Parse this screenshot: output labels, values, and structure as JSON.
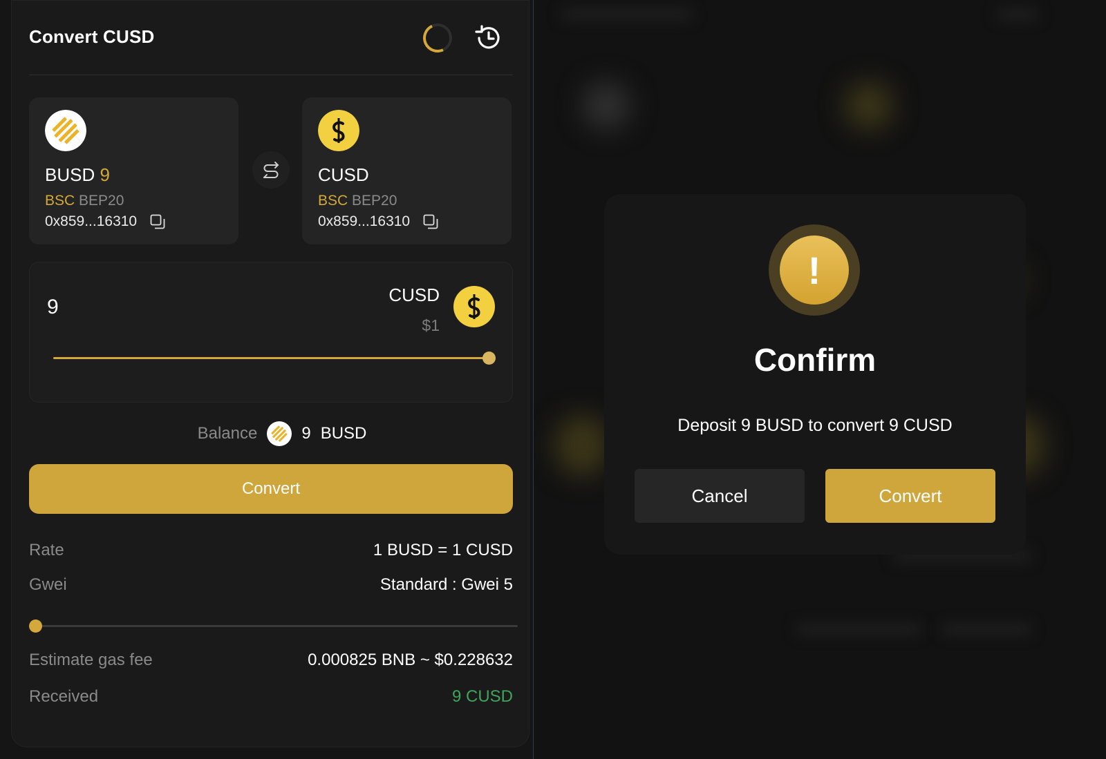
{
  "header": {
    "title": "Convert CUSD"
  },
  "from_token": {
    "name": "BUSD",
    "amount": "9",
    "chain": "BSC",
    "standard": "BEP20",
    "address": "0x859...16310"
  },
  "to_token": {
    "name": "CUSD",
    "chain": "BSC",
    "standard": "BEP20",
    "address": "0x859...16310"
  },
  "amount": {
    "value": "9",
    "symbol": "CUSD",
    "usd": "$1",
    "slider_fraction": 1.0
  },
  "balance": {
    "label": "Balance",
    "value": "9",
    "symbol": "BUSD"
  },
  "convert_button": "Convert",
  "info": {
    "rate_label": "Rate",
    "rate_value": "1 BUSD = 1 CUSD",
    "gwei_label": "Gwei",
    "gwei_value": "Standard : Gwei 5",
    "gwei_slider_fraction": 0.0,
    "gas_label": "Estimate gas fee",
    "gas_value": "0.000825 BNB ~ $0.228632",
    "received_label": "Received",
    "received_value": "9 CUSD"
  },
  "modal": {
    "icon": "!",
    "title": "Confirm",
    "message": "Deposit 9 BUSD to convert 9 CUSD",
    "cancel_label": "Cancel",
    "confirm_label": "Convert"
  },
  "colors": {
    "accent": "#cfa63b",
    "success": "#3fa55a",
    "panel": "#1a1a1a",
    "card": "#242424"
  },
  "icons": [
    "spinner-icon",
    "history-icon",
    "busd-logo-icon",
    "cusd-logo-icon",
    "copy-icon",
    "swap-icon",
    "warning-icon"
  ]
}
